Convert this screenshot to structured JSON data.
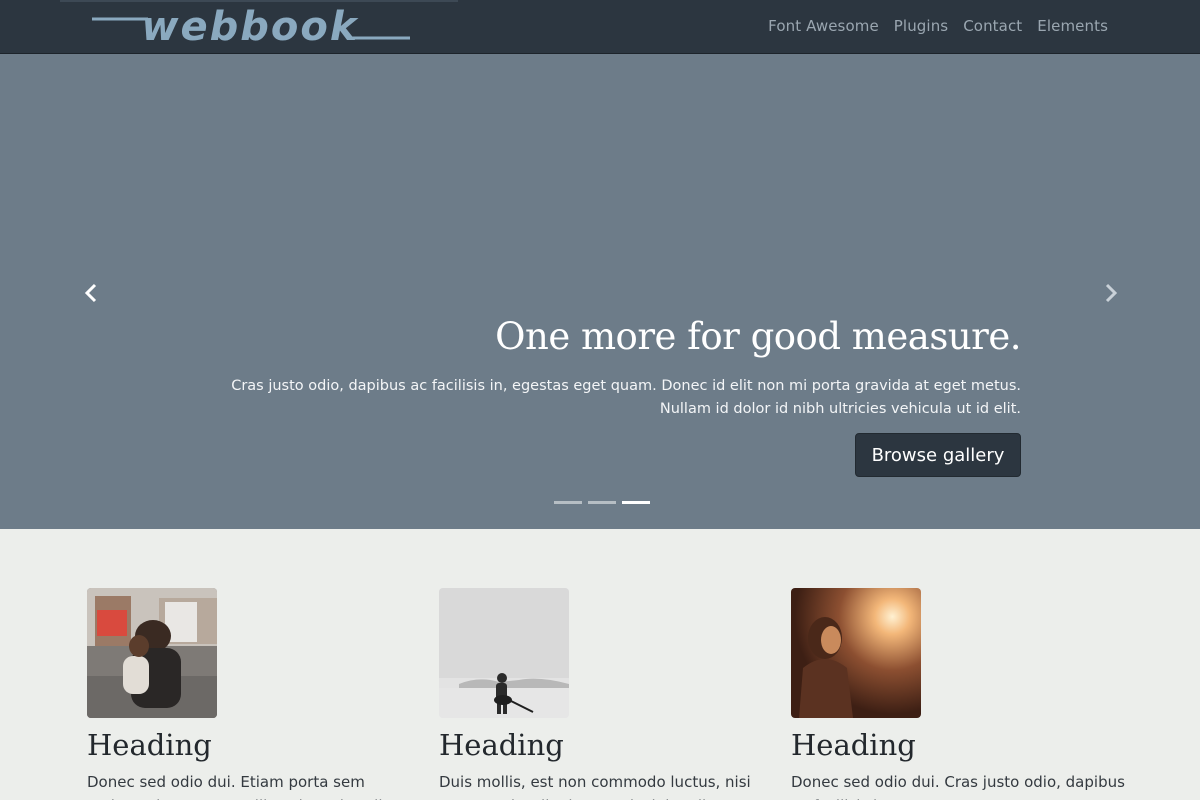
{
  "brand": {
    "logo_text": "webbook",
    "logo_color": "#8aa9bf"
  },
  "nav": {
    "items": [
      {
        "label": "Font Awesome"
      },
      {
        "label": "Plugins"
      },
      {
        "label": "Contact"
      },
      {
        "label": "Elements"
      }
    ]
  },
  "carousel": {
    "heading": "One more for good measure.",
    "text": "Cras justo odio, dapibus ac facilisis in, egestas eget quam. Donec id elit non mi porta gravida at eget metus. Nullam id dolor id nibh ultricies vehicula ut id elit.",
    "button_label": "Browse gallery",
    "slide_count": 3,
    "active_slide": 3,
    "prev_icon": "chevron-left-icon",
    "next_icon": "chevron-right-icon"
  },
  "features": [
    {
      "heading": "Heading",
      "text": "Donec sed odio dui. Etiam porta sem malesuada magna mollis euismod. Nullam"
    },
    {
      "heading": "Heading",
      "text": "Duis mollis, est non commodo luctus, nisi erat porttitor ligula, eget lacinia odio"
    },
    {
      "heading": "Heading",
      "text": "Donec sed odio dui. Cras justo odio, dapibus ac facilisis in, egestas eget quam."
    }
  ],
  "colors": {
    "navbar": "#2c3640",
    "hero": "#6d7c89",
    "page": "#eceeeb",
    "button": "#2c3640"
  }
}
